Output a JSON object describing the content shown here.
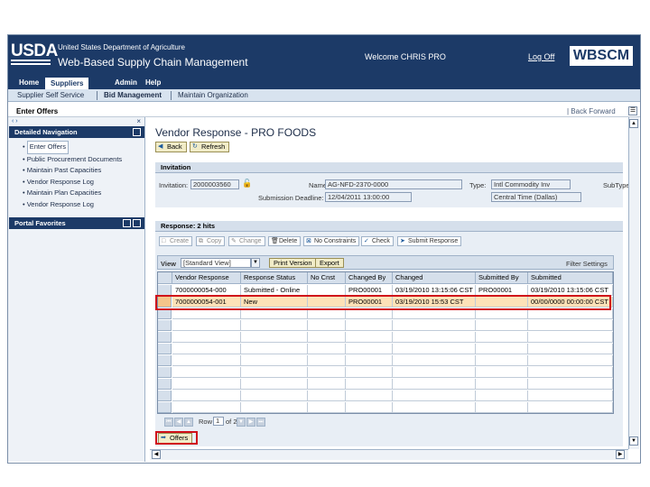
{
  "header": {
    "logo": "USDA",
    "department": "United States Department of Agriculture",
    "app_title": "Web-Based Supply Chain Management",
    "welcome": "Welcome CHRIS PRO",
    "logoff": "Log Off",
    "brand_logo": "WBSCM",
    "banner_color": "#1c3a67"
  },
  "topnav": {
    "tabs": [
      {
        "label": "Home"
      },
      {
        "label": "Suppliers",
        "active": true
      },
      {
        "label": "Admin"
      },
      {
        "label": "Help"
      }
    ]
  },
  "subnav": {
    "items": [
      {
        "label": "Supplier Self Service"
      },
      {
        "label": "Bid Management",
        "active": true
      },
      {
        "label": "Maintain Organization"
      }
    ]
  },
  "breadcrumb": {
    "current": "Enter Offers",
    "history": "| Back Forward"
  },
  "leftnav": {
    "detailed_title": "Detailed Navigation",
    "items": [
      {
        "label": "Enter Offers",
        "selected": true
      },
      {
        "label": "Public Procurement Documents"
      },
      {
        "label": "Maintain Past Capacities"
      },
      {
        "label": "Vendor Response Log"
      },
      {
        "label": "Maintain Plan Capacities"
      },
      {
        "label": "Vendor Response Log"
      }
    ],
    "favorites_title": "Portal Favorites"
  },
  "main": {
    "title": "Vendor Response - PRO FOODS",
    "back_label": "Back",
    "refresh_label": "Refresh",
    "invitation": {
      "section_title": "Invitation",
      "invitation_label": "Invitation:",
      "invitation_value": "2000003560",
      "name_label": "Name:",
      "name_value": "AG-NFD-2370-0000",
      "type_label": "Type:",
      "type_value": "Intl Commodity Inv",
      "sub_type_label": "SubType",
      "deadline_label": "Submission Deadline:",
      "deadline_value": "12/04/2011 13:00:00",
      "timezone_value": "Central Time (Dallas)"
    },
    "response": {
      "section_title": "Response: 2 hits",
      "toolbar": [
        {
          "label": "Create",
          "icon": "create-icon",
          "disabled": true
        },
        {
          "label": "Copy",
          "icon": "copy-icon",
          "disabled": true
        },
        {
          "label": "Change",
          "icon": "pencil-icon",
          "disabled": true
        },
        {
          "label": "Delete",
          "icon": "trash-icon"
        },
        {
          "label": "No Constraints",
          "icon": "constraints-icon"
        },
        {
          "label": "Check",
          "icon": "check-icon"
        },
        {
          "label": "Submit Response",
          "icon": "submit-icon"
        }
      ],
      "view_label": "View",
      "view_value": "[Standard View]",
      "print_version": "Print Version",
      "export": "Export",
      "filter_settings": "Filter Settings",
      "columns": [
        "Vendor Response",
        "Response Status",
        "No Cnst",
        "Changed By",
        "Changed",
        "Submitted By",
        "Submitted"
      ],
      "rows": [
        [
          "7000000054-000",
          "Submitted - Online",
          "",
          "PRO00001",
          "03/19/2010 13:15:06 CST",
          "PRO00001",
          "03/19/2010 13:15:06 CST"
        ],
        [
          "7000000054-001",
          "New",
          "",
          "PRO00001",
          "03/19/2010 15:53 CST",
          "",
          "00/00/0000 00:00:00 CST"
        ]
      ],
      "pager_row_label": "Row",
      "pager_row_value": "1",
      "pager_of": "of 2",
      "offers_label": "Offers"
    }
  }
}
